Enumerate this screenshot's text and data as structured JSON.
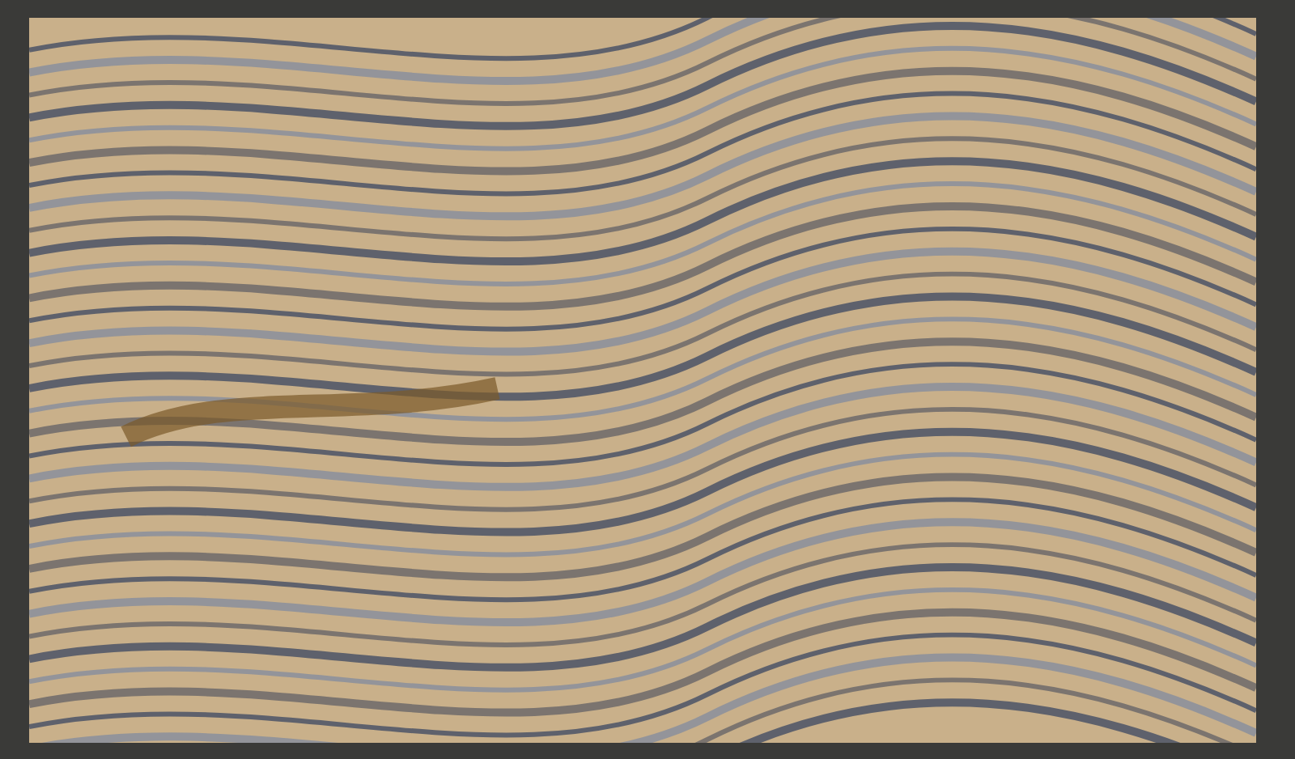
{
  "photo": {
    "kind": "slab"
  }
}
